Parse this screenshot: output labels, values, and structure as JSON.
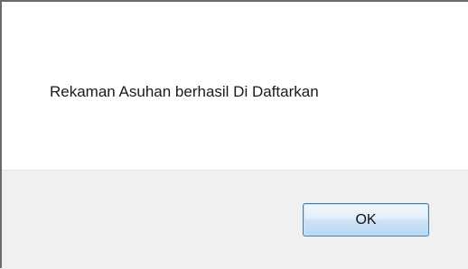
{
  "dialog": {
    "message": "Rekaman Asuhan berhasil Di Daftarkan",
    "ok_label": "OK"
  },
  "colors": {
    "message_background": "#ffffff",
    "button_area_background": "#f0f0f0",
    "button_border": "#3c7fb1"
  }
}
